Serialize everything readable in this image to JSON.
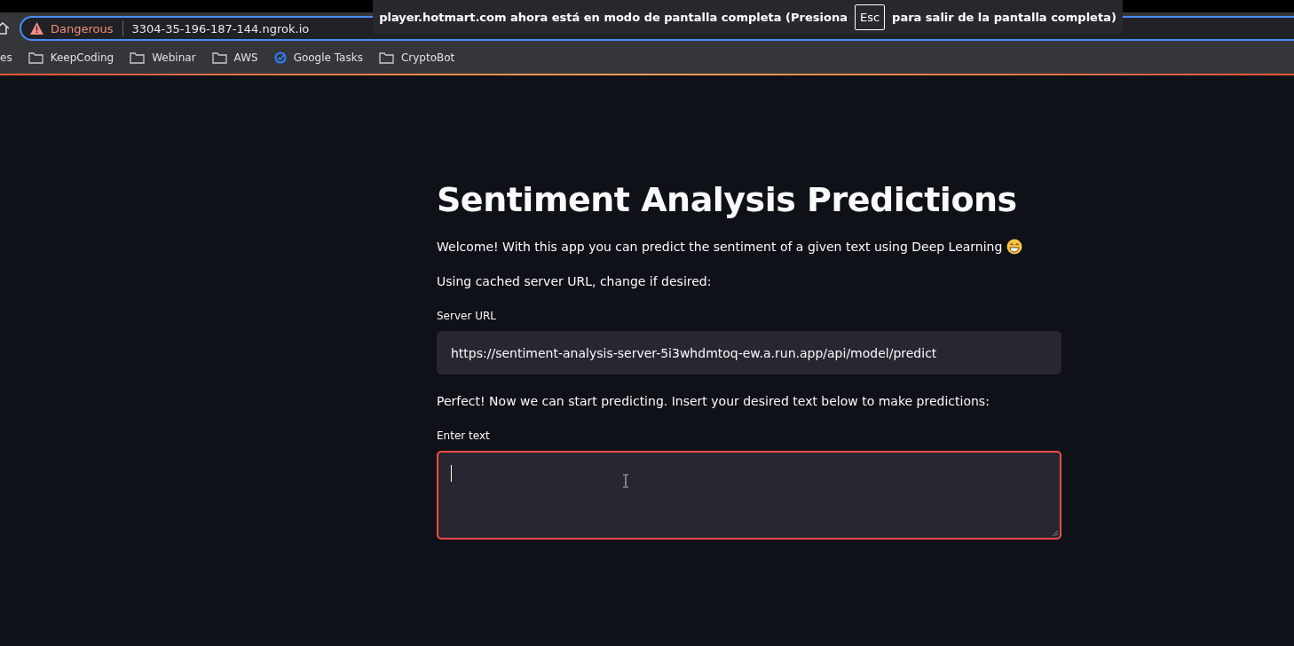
{
  "browser": {
    "security": "Dangerous",
    "address": "3304-35-196-187-144.ngrok.io",
    "bookmarks": [
      {
        "label": "es",
        "kind": "text"
      },
      {
        "label": "KeepCoding",
        "kind": "folder"
      },
      {
        "label": "Webinar",
        "kind": "folder"
      },
      {
        "label": "AWS",
        "kind": "folder"
      },
      {
        "label": "Google Tasks",
        "kind": "tasks"
      },
      {
        "label": "CryptoBot",
        "kind": "folder"
      }
    ],
    "fullscreen_notice": {
      "before": "player.hotmart.com ahora está en modo de pantalla completa (Presiona",
      "key": "Esc",
      "after": "para salir de la pantalla completa)"
    }
  },
  "page": {
    "title": "Sentiment Analysis Predictions",
    "welcome": "Welcome! With this app you can predict the sentiment of a given text using Deep Learning",
    "cached_note": "Using cached server URL, change if desired:",
    "server_field": {
      "label": "Server URL",
      "value": "https://sentiment-analysis-server-5i3whdmtoq-ew.a.run.app/api/model/predict",
      "focused": false
    },
    "ready_note": "Perfect! Now we can start predicting. Insert your desired text below to make predictions:",
    "text_field": {
      "label": "Enter text",
      "focused": true
    }
  }
}
